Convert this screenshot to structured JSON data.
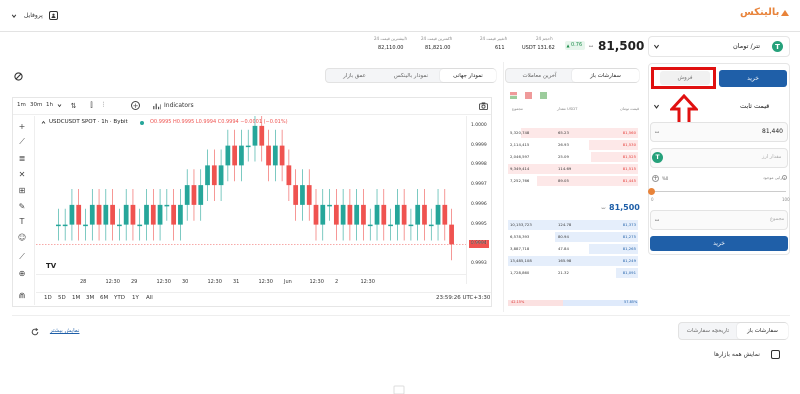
{
  "header": {
    "brand": "بالینکس",
    "profile_label": "پروفایل"
  },
  "market": {
    "price": "81,500",
    "change": "0.76",
    "stats": [
      {
        "label": "حجم 24h",
        "value": "USDT 131.62"
      },
      {
        "label": "تغییر قیمت 24h",
        "value": "611"
      },
      {
        "label": "کمترین قیمت 24h",
        "value": "81,821.00"
      },
      {
        "label": "بیشترین قیمت 24h",
        "value": "82,110.00"
      }
    ]
  },
  "trade": {
    "pair_label": "تتر/ تومان",
    "buy_tab": "خرید",
    "sell_tab": "فروش",
    "price_type": "قیمت ثابت",
    "price_value": "81,440",
    "amount_placeholder": "مقدار ارز",
    "slider_label": "دارایی موجود",
    "slider_min": "0",
    "slider_max": "100",
    "slider_value_label": "%0",
    "total_placeholder": "مجموع",
    "submit": "خرید",
    "highlight_color": "#e01010"
  },
  "orderbook": {
    "tabs": [
      "سفارشات باز",
      "آخرین معاملات"
    ],
    "headers": [
      "قیمت تومان",
      "مقدار USDT",
      "مجموع"
    ],
    "asks": [
      {
        "price": "81,560",
        "amount": "65.23",
        "total": "5,320,748",
        "depth": 0.9
      },
      {
        "price": "81,530",
        "amount": "26.93",
        "total": "2,114,415",
        "depth": 0.38
      },
      {
        "price": "81,525",
        "amount": "25.09",
        "total": "2,046,597",
        "depth": 0.36
      },
      {
        "price": "81,515",
        "amount": "114.69",
        "total": "9,349,414",
        "depth": 1.0
      },
      {
        "price": "81,445",
        "amount": "89.05",
        "total": "7,252,766",
        "depth": 0.78
      }
    ],
    "mid_price": "81,500",
    "bids": [
      {
        "price": "81,373",
        "amount": "124.78",
        "total": "10,153,723",
        "depth": 1.0
      },
      {
        "price": "81,275",
        "amount": "80.94",
        "total": "6,578,393",
        "depth": 0.64
      },
      {
        "price": "81,265",
        "amount": "47.84",
        "total": "3,887,718",
        "depth": 0.38
      },
      {
        "price": "81,249",
        "amount": "165.98",
        "total": "13,485,108",
        "depth": 1.0
      },
      {
        "price": "81,091",
        "amount": "21.32",
        "total": "1,728,860",
        "depth": 0.17
      }
    ],
    "ratio_buy": "57.85%",
    "ratio_sell": "42.15%",
    "buy_fraction": 0.58
  },
  "chart_panel": {
    "tabs": [
      "نمودار جهانی",
      "نمودار بالینکس",
      "عمق بازار"
    ],
    "timeframes": [
      "1m",
      "30m",
      "1h"
    ],
    "indicators": "Indicators",
    "symbol": "USDCUSDT SPOT · 1h · Bybit",
    "ohlc": "O0.9995 H0.9995 L0.9994 C0.9994 −0.0001 (−0.01%)",
    "y_ticks": [
      "1.0000",
      "0.9999",
      "0.9998",
      "0.9997",
      "0.9996",
      "0.9995",
      "0.9994",
      "0.9993"
    ],
    "last_price": "0.9994",
    "x_ticks": [
      "28",
      "12:30",
      "29",
      "12:30",
      "30",
      "12:30",
      "31",
      "12:30",
      "Jun",
      "12:30",
      "2",
      "12:30"
    ],
    "ranges": [
      "1D",
      "5D",
      "1M",
      "3M",
      "6M",
      "YTD",
      "1Y",
      "All"
    ],
    "clock": "23:59:26 UTC+3:30",
    "logo": "TV"
  },
  "chart_data": {
    "type": "bar",
    "title": "USDCUSDT SPOT · 1h · Bybit",
    "ylim": [
      0.99925,
      1.00005
    ],
    "y_ticks": [
      1.0,
      0.9999,
      0.9998,
      0.9997,
      0.9996,
      0.9995,
      0.9994,
      0.9993
    ],
    "x_ticks": [
      "28",
      "12:30",
      "29",
      "12:30",
      "30",
      "12:30",
      "31",
      "12:30",
      "Jun",
      "12:30",
      "2",
      "12:30"
    ],
    "series": [
      {
        "values": [
          0.9995,
          0.9995,
          0.9996,
          0.9995,
          0.9995,
          0.9996,
          0.9995,
          0.9996,
          0.9995,
          0.9995,
          0.9996,
          0.9995,
          0.9995,
          0.9996,
          0.9995,
          0.9996,
          0.9996,
          0.9995,
          0.9996,
          0.9997,
          0.9996,
          0.9997,
          0.9998,
          0.9997,
          0.9998,
          0.9999,
          0.9998,
          0.9999,
          0.9999,
          1.0,
          0.9999,
          0.9998,
          0.9999,
          0.9998,
          0.9997,
          0.9996,
          0.9997,
          0.9996,
          0.9995,
          0.9996,
          0.9996,
          0.9995,
          0.9996,
          0.9995,
          0.9996,
          0.9995,
          0.9995,
          0.9996,
          0.9995,
          0.9995,
          0.9996,
          0.9995,
          0.9995,
          0.9996,
          0.9995,
          0.9995,
          0.9996,
          0.9995,
          0.9994
        ]
      }
    ]
  },
  "bottom": {
    "tabs": [
      "سفارشات باز",
      "تاریخچه سفارشات"
    ],
    "show_more": "نمایش بیشتر",
    "checkbox_label": "نمایش همه بازارها"
  },
  "colors": {
    "green": "#26a69a",
    "red": "#ef5350",
    "blue": "#1f5fa8",
    "brand": "#e8833a"
  }
}
